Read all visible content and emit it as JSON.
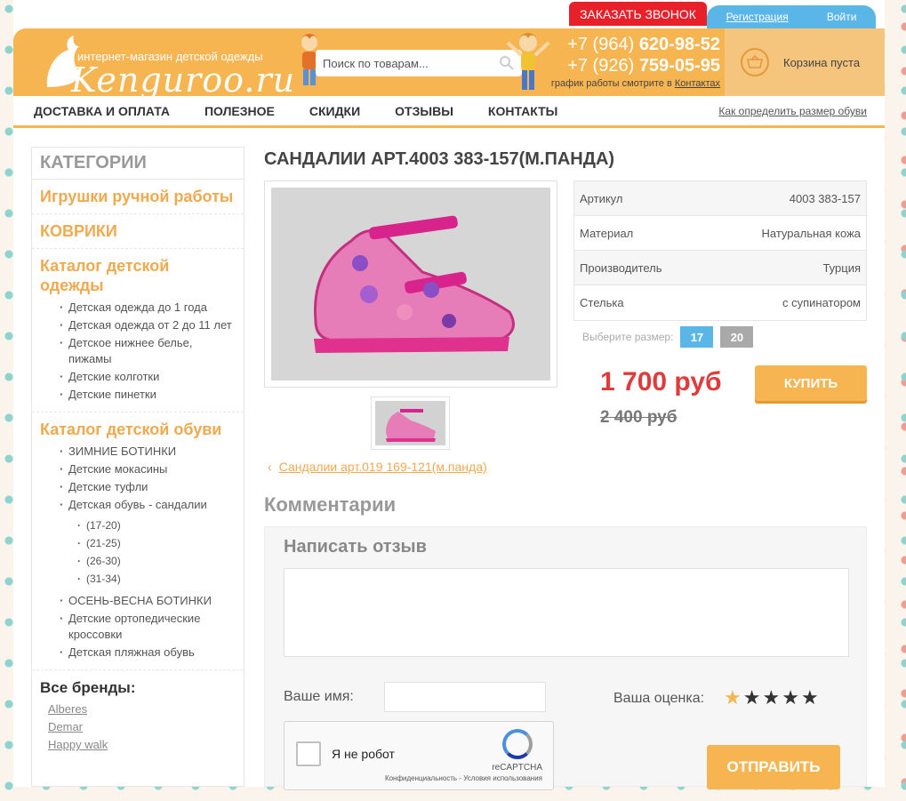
{
  "topbar": {
    "call_label": "ЗАКАЗАТЬ ЗВОНОК",
    "register_label": "Регистрация",
    "login_label": "Войти"
  },
  "header": {
    "tagline": "интернет-магазин детской одежды",
    "logo_text": "Kenguroo.ru",
    "search_placeholder": "Поиск по товарам...",
    "phone1_prefix": "+7 (964)",
    "phone1_number": "620-98-52",
    "phone2_prefix": "+7 (926)",
    "phone2_number": "759-05-95",
    "schedule_text": "график работы смотрите в",
    "schedule_link": "Контактах",
    "cart_label": "Корзина пуста"
  },
  "nav": {
    "items": [
      "ДОСТАВКА И ОПЛАТА",
      "ПОЛЕЗНОЕ",
      "СКИДКИ",
      "ОТЗЫВЫ",
      "КОНТАКТЫ"
    ],
    "size_link": "Как определить размер обуви"
  },
  "sidebar": {
    "heading": "КАТЕГОРИИ",
    "cat_toys": "Игрушки ручной работы",
    "cat_rugs": "КОВРИКИ",
    "cat_clothes": "Каталог детской одежды",
    "clothes_items": [
      "Детская одежда до 1 года",
      "Детская одежда от 2 до 11 лет",
      "Детское нижнее белье, пижамы",
      "Детские колготки",
      "Детские пинетки"
    ],
    "cat_shoes": "Каталог детской обуви",
    "shoes_items_a": [
      "ЗИМНИЕ БОТИНКИ",
      "Детские мокасины",
      "Детские туфли",
      "Детская обувь - сандалии"
    ],
    "sandal_sizes": [
      "(17-20)",
      "(21-25)",
      "(26-30)",
      "(31-34)"
    ],
    "shoes_items_b": [
      "ОСЕНЬ-ВЕСНА БОТИНКИ",
      "Детские ортопедические кроссовки",
      "Детская пляжная обувь"
    ],
    "brands_title": "Все бренды:",
    "brands": [
      "Alberes",
      "Demar",
      "Happy walk"
    ]
  },
  "product": {
    "title": "САНДАЛИИ АРТ.4003 383-157(М.ПАНДА)",
    "props": [
      {
        "label": "Артикул",
        "value": "4003 383-157"
      },
      {
        "label": "Материал",
        "value": "Натуральная кожа"
      },
      {
        "label": "Производитель",
        "value": "Турция"
      },
      {
        "label": "Стелька",
        "value": "с супинатором"
      }
    ],
    "size_label": "Выберите размер:",
    "sizes": [
      {
        "label": "17",
        "color": "#5bb6e8"
      },
      {
        "label": "20",
        "color": "#a9a9a9"
      }
    ],
    "price": "1 700 руб",
    "old_price": "2 400 руб",
    "buy_label": "КУПИТЬ",
    "prev_link": "Сандалии арт.019 169-121(м.панда)"
  },
  "comments": {
    "title": "Комментарии",
    "form_title": "Написать отзыв",
    "name_label": "Ваше имя:",
    "rating_label": "Ваша оценка:",
    "rating_value": 1,
    "rating_max": 5,
    "captcha_label": "Я не робот",
    "captcha_brand": "reCAPTCHA",
    "captcha_terms": "Конфиденциальность - Условия использования",
    "submit_label": "ОТПРАВИТЬ"
  },
  "colors": {
    "accent": "#f7b552",
    "price": "#e03a3a",
    "call": "#e8202a",
    "auth": "#5bb6e8"
  }
}
